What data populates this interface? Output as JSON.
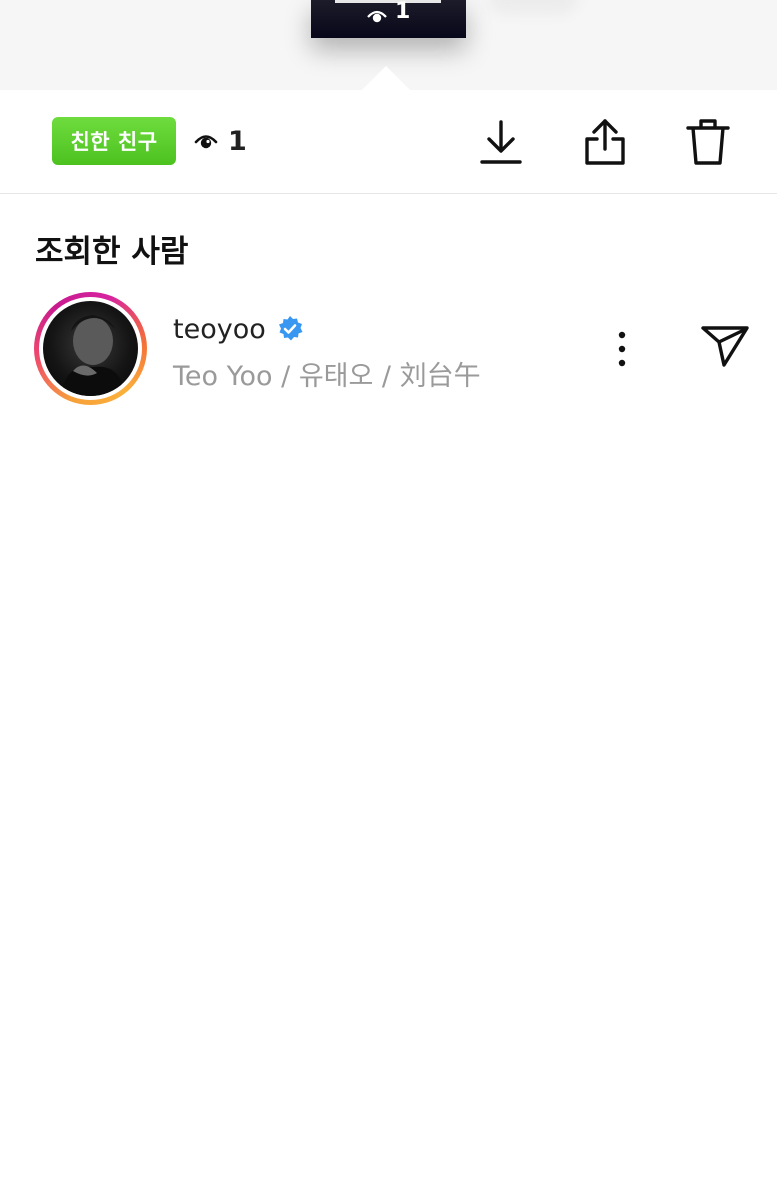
{
  "story_preview": {
    "viewer_count": "1",
    "icon": "eye-icon"
  },
  "toolbar": {
    "close_friends_label": "친한 친구",
    "close_friends_color": "#5ccf2d",
    "viewer_count": "1",
    "icons": [
      "eye-icon",
      "download-icon",
      "share-icon",
      "trash-icon"
    ]
  },
  "viewers": {
    "title": "조회한 사람",
    "items": [
      {
        "username": "teoyoo",
        "verified": true,
        "verified_color": "#3897f0",
        "full_name": "Teo Yoo / 유태오 / 刘台午",
        "icons": [
          "more-options-icon",
          "send-message-icon"
        ]
      }
    ]
  }
}
